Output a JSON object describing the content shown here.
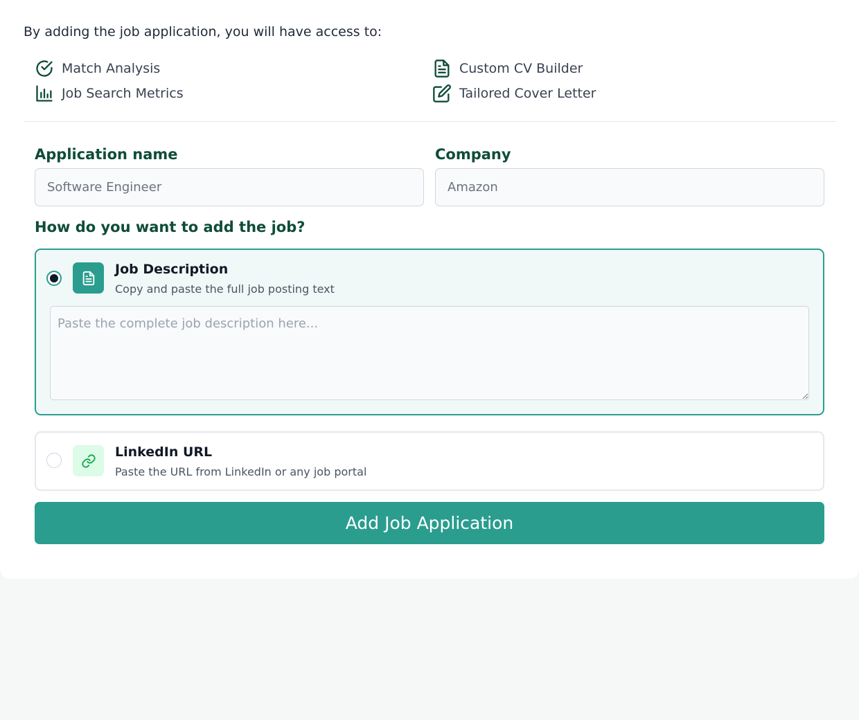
{
  "intro": {
    "text": "By adding the job application, you will have access to:"
  },
  "features": [
    {
      "label": "Match Analysis",
      "icon": "check-circle-icon"
    },
    {
      "label": "Job Search Metrics",
      "icon": "bar-chart-icon"
    },
    {
      "label": "Custom CV Builder",
      "icon": "document-icon"
    },
    {
      "label": "Tailored Cover Letter",
      "icon": "edit-icon"
    }
  ],
  "form": {
    "application_name": {
      "label": "Application name",
      "placeholder": "Software Engineer"
    },
    "company": {
      "label": "Company",
      "placeholder": "Amazon"
    },
    "method_question": "How do you want to add the job?",
    "options": [
      {
        "title": "Job Description",
        "description": "Copy and paste the full job posting text",
        "icon": "document-icon",
        "selected": true,
        "textarea_placeholder": "Paste the complete job description here..."
      },
      {
        "title": "LinkedIn URL",
        "description": "Paste the URL from LinkedIn or any job portal",
        "icon": "link-icon",
        "selected": false
      }
    ],
    "submit_label": "Add Job Application"
  },
  "colors": {
    "accent": "#2a9d8f",
    "heading": "#0f4c3a",
    "selected_bg": "#f0f9f7",
    "link_icon_bg": "#dcfce7"
  }
}
